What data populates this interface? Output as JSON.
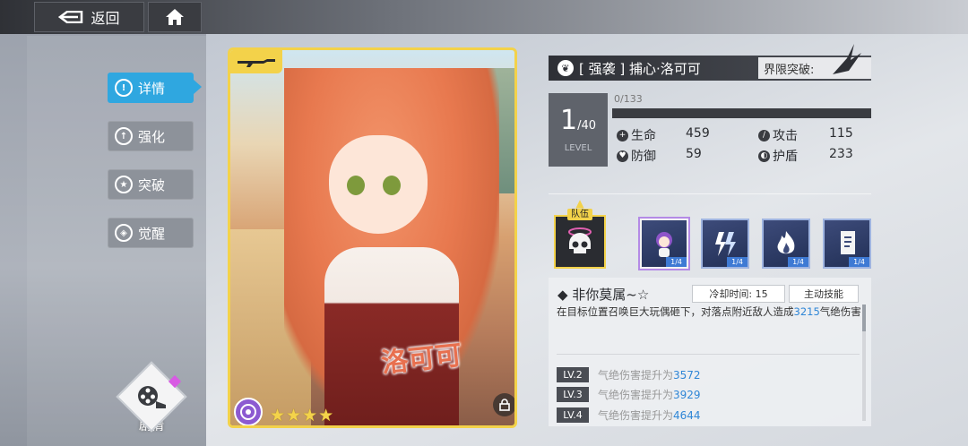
{
  "topbar": {
    "back_label": "返回"
  },
  "menu": [
    {
      "label": "详情",
      "icon": "info-icon",
      "active": true
    },
    {
      "label": "强化",
      "icon": "enhance-icon",
      "active": false
    },
    {
      "label": "突破",
      "icon": "breakthrough-icon",
      "active": false
    },
    {
      "label": "觉醒",
      "icon": "awaken-icon",
      "active": false
    }
  ],
  "story": {
    "label": "剧情"
  },
  "card": {
    "name": "洛可可",
    "stars": 4,
    "weapon_icon": "rifle-icon",
    "element_icon": "element-icon"
  },
  "character": {
    "title": "[ 强袭 ] 捕心·洛可可",
    "limit_label": "界限突破:",
    "level": "1",
    "level_max": "/40",
    "level_label": "LEVEL",
    "exp": "0/133",
    "exp_fraction": 0.0
  },
  "stats": {
    "hp_label": "生命",
    "hp": "459",
    "atk_label": "攻击",
    "atk": "115",
    "def_label": "防御",
    "def": "59",
    "shield_label": "护盾",
    "shield": "233"
  },
  "team": {
    "label": "队伍"
  },
  "skills": [
    {
      "icon": "chibi-character-icon",
      "level": "1/4",
      "selected": true
    },
    {
      "icon": "lightning-icon",
      "level": "1/4",
      "selected": false
    },
    {
      "icon": "fire-icon",
      "level": "1/4",
      "selected": false
    },
    {
      "icon": "seal-icon",
      "level": "1/4",
      "selected": false
    }
  ],
  "skill_detail": {
    "name": "◆ 非你莫属~☆",
    "cooldown": "冷却时间: 15",
    "type": "主动技能",
    "desc_before": "在目标位置召唤巨大玩偶砸下，对落点附近敌人造成",
    "desc_value": "3215",
    "desc_after": "气绝伤害",
    "levels": [
      {
        "tag": "LV.2",
        "text": "气绝伤害提升为",
        "value": "3572"
      },
      {
        "tag": "LV.3",
        "text": "气绝伤害提升为",
        "value": "3929"
      },
      {
        "tag": "LV.4",
        "text": "气绝伤害提升为",
        "value": "4644"
      }
    ]
  }
}
